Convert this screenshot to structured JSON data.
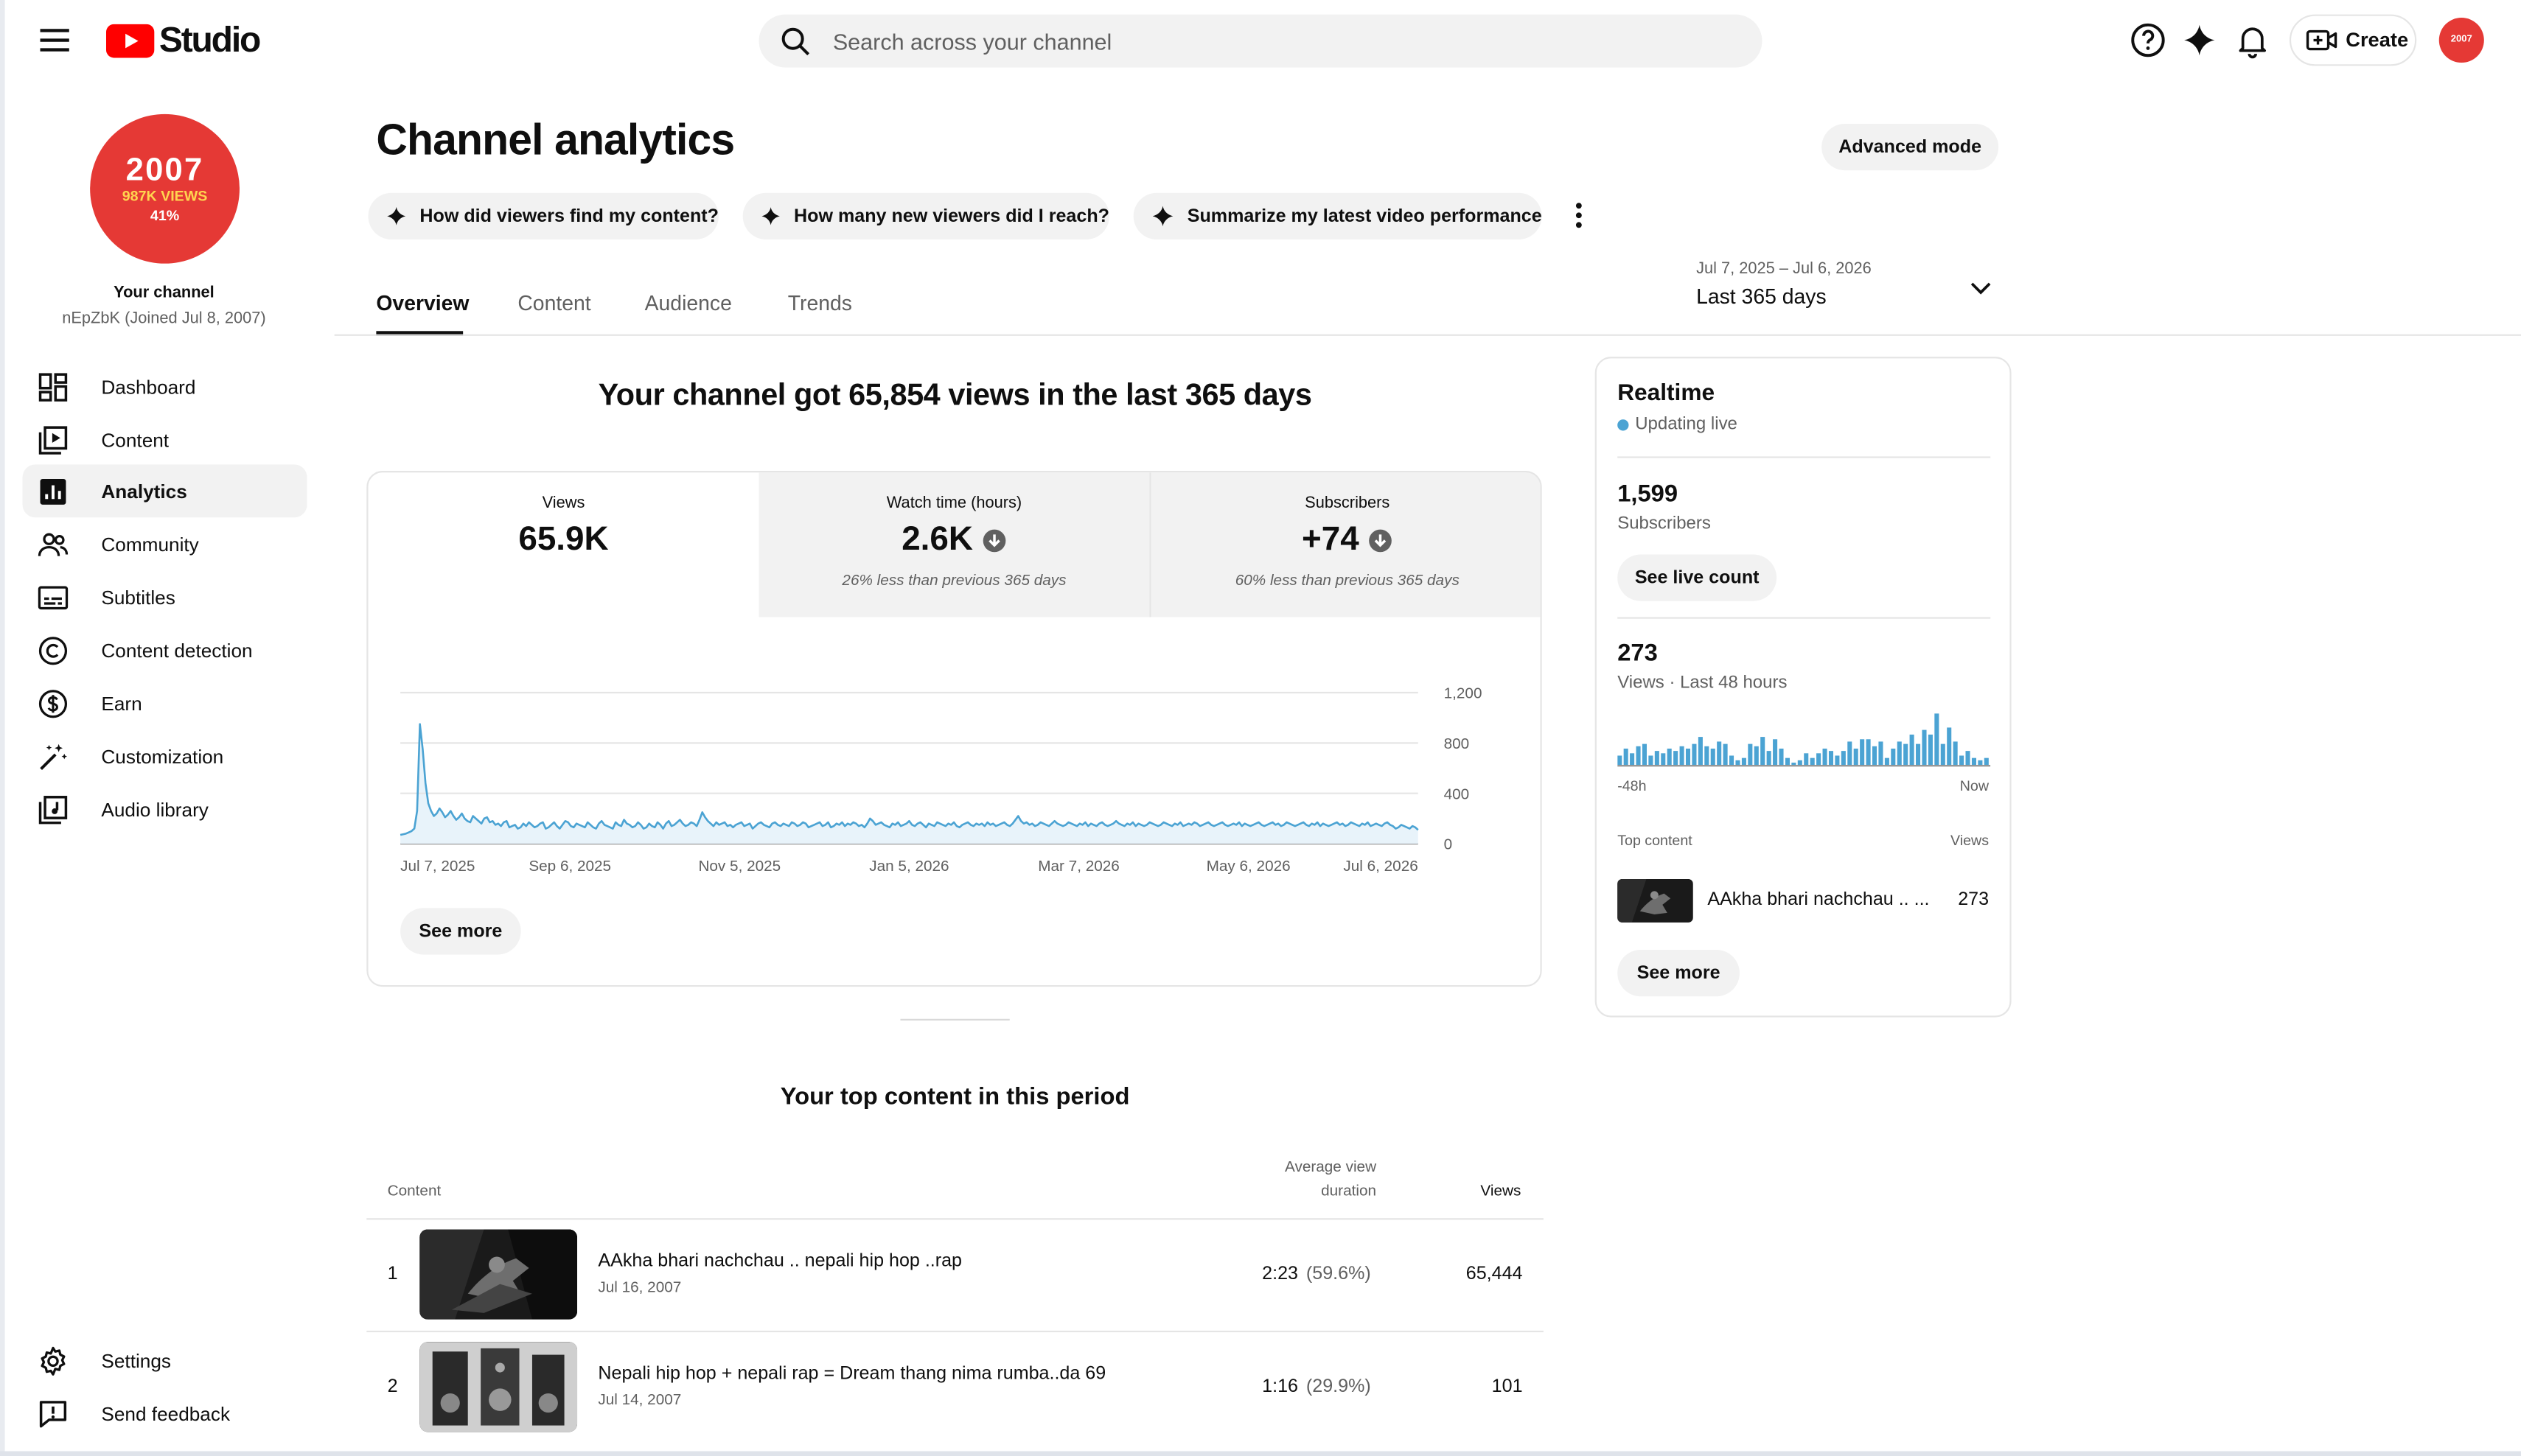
{
  "header": {
    "app_name": "Studio",
    "search_placeholder": "Search across your channel",
    "create_label": "Create",
    "avatar_text": "2007"
  },
  "sidebar": {
    "avatar": {
      "year": "2007",
      "views": "987K VIEWS",
      "percent": "41%"
    },
    "your_channel": "Your channel",
    "handle": "nEpZbK (Joined Jul 8, 2007)",
    "items": [
      {
        "label": "Dashboard",
        "icon": "dashboard-icon"
      },
      {
        "label": "Content",
        "icon": "content-icon"
      },
      {
        "label": "Analytics",
        "icon": "analytics-icon",
        "active": true
      },
      {
        "label": "Community",
        "icon": "community-icon"
      },
      {
        "label": "Subtitles",
        "icon": "subtitles-icon"
      },
      {
        "label": "Content detection",
        "icon": "copyright-icon"
      },
      {
        "label": "Earn",
        "icon": "dollar-icon"
      },
      {
        "label": "Customization",
        "icon": "magic-wand-icon"
      },
      {
        "label": "Audio library",
        "icon": "audio-library-icon"
      }
    ],
    "bottom_items": [
      {
        "label": "Settings",
        "icon": "gear-icon"
      },
      {
        "label": "Send feedback",
        "icon": "feedback-icon"
      }
    ]
  },
  "main": {
    "title": "Channel analytics",
    "advanced_mode": "Advanced mode",
    "chips": [
      "How did viewers find my content?",
      "How many new viewers did I reach?",
      "Summarize my latest video performance"
    ],
    "tabs": [
      "Overview",
      "Content",
      "Audience",
      "Trends"
    ],
    "active_tab": "Overview",
    "date_range": {
      "dates": "Jul 7, 2025 – Jul 6, 2026",
      "label": "Last 365 days"
    },
    "summary": "Your channel got 65,854 views in the last 365 days",
    "metrics": [
      {
        "label": "Views",
        "value": "65.9K",
        "note": ""
      },
      {
        "label": "Watch time (hours)",
        "value": "2.6K",
        "note": "26% less than previous 365 days",
        "trend": "down"
      },
      {
        "label": "Subscribers",
        "value": "+74",
        "note": "60% less than previous 365 days",
        "trend": "down"
      }
    ],
    "see_more": "See more",
    "top_content": {
      "title": "Your top content in this period",
      "headers": {
        "content": "Content",
        "avg_line1": "Average view",
        "avg_line2": "duration",
        "views": "Views"
      },
      "rows": [
        {
          "rank": "1",
          "title": "AAkha bhari nachchau .. nepali hip hop ..rap",
          "date": "Jul 16, 2007",
          "duration": "2:23",
          "percent": "(59.6%)",
          "views": "65,444"
        },
        {
          "rank": "2",
          "title": "Nepali hip hop + nepali rap = Dream thang nima rumba..da 69",
          "date": "Jul 14, 2007",
          "duration": "1:16",
          "percent": "(29.9%)",
          "views": "101"
        }
      ]
    }
  },
  "realtime": {
    "title": "Realtime",
    "status": "Updating live",
    "subscribers": "1,599",
    "subscribers_label": "Subscribers",
    "see_live_count": "See live count",
    "views": "273",
    "views_label": "Views · Last 48 hours",
    "axis_start": "-48h",
    "axis_end": "Now",
    "top_content_label": "Top content",
    "views_col_label": "Views",
    "top_item": {
      "title": "AAkha bhari nachchau .. ...",
      "views": "273"
    },
    "see_more": "See more",
    "hourly_views": [
      4,
      7,
      5,
      8,
      9,
      4,
      6,
      5,
      7,
      6,
      8,
      7,
      9,
      12,
      8,
      7,
      10,
      9,
      4,
      2,
      3,
      9,
      8,
      12,
      6,
      11,
      7,
      3,
      1,
      2,
      5,
      3,
      5,
      7,
      6,
      4,
      6,
      10,
      7,
      11,
      11,
      8,
      10,
      3,
      7,
      10,
      9,
      13,
      9,
      15,
      13,
      22,
      9,
      16,
      10,
      4,
      6,
      3,
      2,
      3
    ]
  },
  "colors": {
    "brand_red": "#ff0000",
    "chart_line": "#4ba3d3",
    "chart_fill": "#e8f3fa",
    "accent_dot": "#4ba3d3"
  },
  "chart_data": {
    "type": "area",
    "title": "",
    "xlabel": "",
    "ylabel": "",
    "x_ticks": [
      "Jul 7, 2025",
      "Sep 6, 2025",
      "Nov 5, 2025",
      "Jan 5, 2026",
      "Mar 7, 2026",
      "May 6, 2026",
      "Jul 6, 2026"
    ],
    "y_ticks": [
      "0",
      "400",
      "800",
      "1,200"
    ],
    "ylim": [
      0,
      1200
    ],
    "grid": true,
    "series": [
      {
        "values": [
          70,
          75,
          80,
          90,
          100,
          120,
          260,
          950,
          750,
          480,
          320,
          260,
          220,
          240,
          280,
          250,
          210,
          230,
          260,
          220,
          190,
          210,
          240,
          200,
          180,
          170,
          220,
          200,
          180,
          160,
          200,
          210,
          170,
          180,
          150,
          160,
          140,
          170,
          180,
          130,
          140,
          150,
          120,
          130,
          160,
          140,
          170,
          150,
          130,
          140,
          160,
          170,
          120,
          130,
          150,
          170,
          140,
          120,
          150,
          180,
          170,
          140,
          130,
          160,
          150,
          140,
          130,
          170,
          150,
          130,
          120,
          160,
          180,
          150,
          140,
          130,
          120,
          170,
          150,
          140,
          190,
          160,
          150,
          130,
          140,
          170,
          150,
          120,
          130,
          160,
          140,
          130,
          170,
          150,
          120,
          160,
          180,
          140,
          150,
          170,
          190,
          160,
          140,
          150,
          170,
          160,
          140,
          190,
          250,
          210,
          180,
          160,
          140,
          170,
          150,
          160,
          170,
          140,
          150,
          130,
          150,
          160,
          170,
          140,
          150,
          160,
          120,
          140,
          160,
          170,
          150,
          140,
          130,
          160,
          170,
          150,
          140,
          160,
          150,
          140,
          170,
          160,
          140,
          150,
          170,
          160,
          130,
          140,
          150,
          160,
          170,
          140,
          150,
          170,
          130,
          140,
          160,
          150,
          170,
          140,
          160,
          150,
          170,
          160,
          140,
          150,
          130,
          160,
          200,
          180,
          150,
          160,
          170,
          150,
          140,
          130,
          160,
          150,
          170,
          140,
          150,
          160,
          180,
          150,
          140,
          160,
          170,
          150,
          130,
          160,
          150,
          140,
          170,
          160,
          150,
          140,
          160,
          150,
          170,
          140,
          130,
          150,
          160,
          170,
          150,
          140,
          160,
          150,
          160,
          140,
          170,
          150,
          160,
          140,
          150,
          160,
          170,
          150,
          140,
          160,
          190,
          220,
          180,
          160,
          170,
          150,
          160,
          140,
          150,
          170,
          160,
          150,
          140,
          160,
          180,
          160,
          150,
          140,
          150,
          170,
          160,
          150,
          140,
          160,
          150,
          170,
          140,
          160,
          150,
          140,
          160,
          170,
          150,
          140,
          150,
          160,
          180,
          160,
          150,
          140,
          160,
          150,
          170,
          140,
          160,
          150,
          140,
          150,
          170,
          160,
          150,
          140,
          150,
          170,
          160,
          150,
          140,
          160,
          150,
          170,
          140,
          150,
          160,
          150,
          170,
          160,
          140,
          150,
          160,
          170,
          150,
          140,
          150,
          160,
          170,
          150,
          140,
          150,
          160,
          150,
          170,
          140,
          160,
          150,
          140,
          150,
          160,
          170,
          150,
          140,
          150,
          160,
          170,
          150,
          160,
          140,
          150,
          170,
          160,
          150,
          140,
          150,
          160,
          170,
          150,
          140,
          160,
          150,
          170,
          140,
          160,
          150,
          140,
          150,
          160,
          170,
          150,
          160,
          140,
          150,
          170,
          160,
          150,
          140,
          160,
          150,
          170,
          140,
          150,
          160,
          150,
          140,
          160,
          170,
          150,
          140,
          120,
          130,
          150,
          140,
          130,
          120,
          140,
          130,
          110
        ]
      }
    ]
  }
}
